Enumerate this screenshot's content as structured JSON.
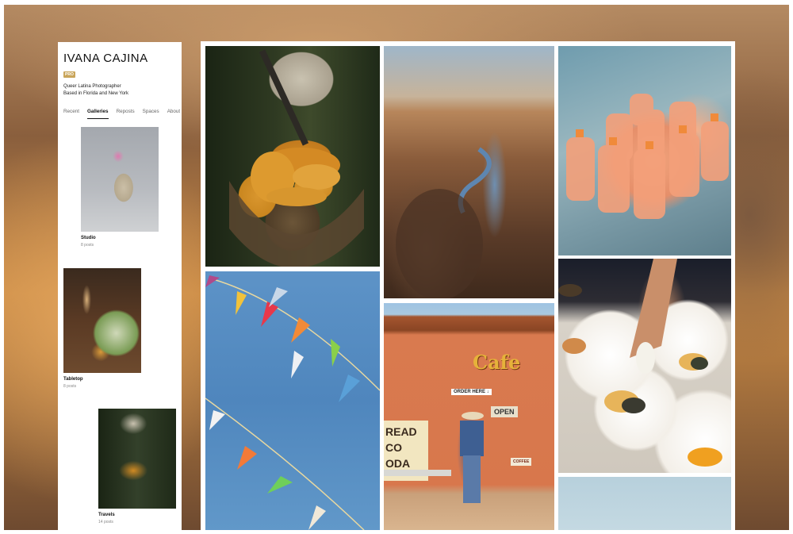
{
  "profile": {
    "name": "IVANA CAJINA",
    "badge": "PRO",
    "bio_line1": "Queer Latina Photographer",
    "bio_line2": "Based in Florida and New York"
  },
  "tabs": [
    {
      "label": "Recent",
      "active": false
    },
    {
      "label": "Galleries",
      "active": true
    },
    {
      "label": "Reposts",
      "active": false
    },
    {
      "label": "Spaces",
      "active": false
    },
    {
      "label": "About",
      "active": false
    }
  ],
  "galleries": [
    {
      "title": "Studio",
      "count": "8 posts"
    },
    {
      "title": "Tabletop",
      "count": "8 posts"
    },
    {
      "title": "Travels",
      "count": "14 posts"
    }
  ],
  "photos": {
    "cafe_sign": "Cafe",
    "order_here": "ORDER HERE ↓",
    "open": "OPEN",
    "coffee": "COFFEE",
    "bread": "READ",
    "co": "CO",
    "oda": "ODA"
  },
  "colors": {
    "badge": "#c9a55a",
    "sidebar_bg": "#ffffff",
    "panel_bg": "#ffffff"
  }
}
